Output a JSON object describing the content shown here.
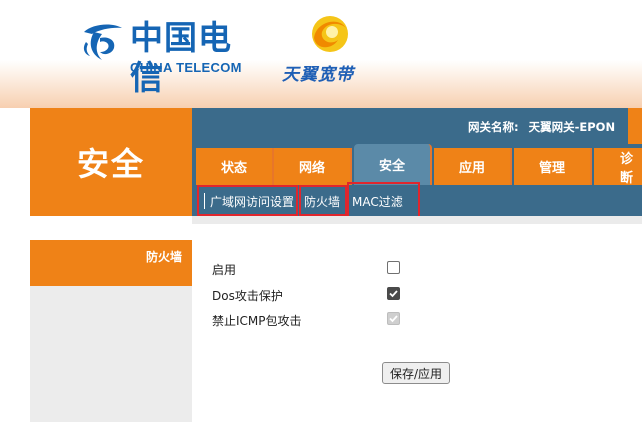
{
  "brand": {
    "ct_cn": "中国电信",
    "ct_en": "CHINA TELECOM",
    "tianyi": "天翼宽带"
  },
  "section_title": "安全",
  "gateway": {
    "label": "网关名称:",
    "name": "天翼网关-EPON"
  },
  "tabs": [
    {
      "label": "状态",
      "active": false
    },
    {
      "label": "网络",
      "active": false
    },
    {
      "label": "安全",
      "active": true
    },
    {
      "label": "应用",
      "active": false
    },
    {
      "label": "管理",
      "active": false
    },
    {
      "label": "诊断",
      "active": false
    }
  ],
  "subnav": [
    {
      "label": "广域网访问设置"
    },
    {
      "label": "防火墙"
    },
    {
      "label": "MAC过滤"
    }
  ],
  "left_menu": {
    "items": [
      {
        "label": "防火墙",
        "active": true
      }
    ]
  },
  "firewall": {
    "options": [
      {
        "label": "启用",
        "checked": false,
        "disabled": false
      },
      {
        "label": "Dos攻击保护",
        "checked": true,
        "disabled": false
      },
      {
        "label": "禁止ICMP包攻击",
        "checked": true,
        "disabled": true
      }
    ],
    "save_label": "保存/应用"
  },
  "colors": {
    "orange": "#ef8217",
    "nav_blue": "#3b6b8b",
    "active_tab": "#5b8aa8",
    "highlight_red": "#e0262d",
    "brand_blue": "#1565b4"
  }
}
